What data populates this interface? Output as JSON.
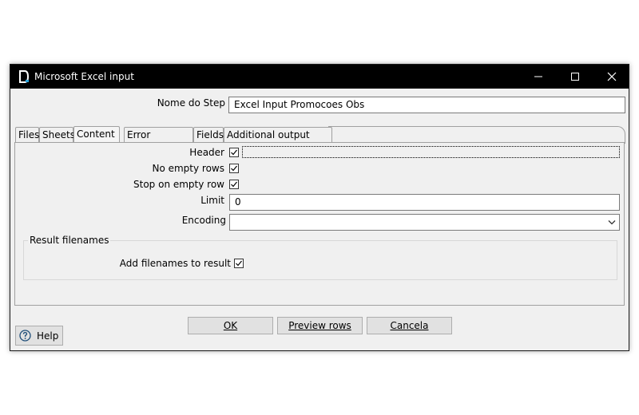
{
  "window": {
    "title": "Microsoft Excel input",
    "controls": {
      "minimize": "—",
      "maximize": "☐",
      "close": "✕"
    }
  },
  "step": {
    "label": "Nome do Step",
    "value": "Excel Input Promocoes Obs"
  },
  "tabs": [
    {
      "label": "Files"
    },
    {
      "label": "Sheets"
    },
    {
      "label": "Content",
      "active": true
    },
    {
      "label": "Error Handling"
    },
    {
      "label": "Fields"
    },
    {
      "label": "Additional output fields"
    }
  ],
  "content": {
    "header": {
      "label": "Header",
      "checked": true
    },
    "no_empty_rows": {
      "label": "No empty rows",
      "checked": true
    },
    "stop_on_empty_row": {
      "label": "Stop on empty row",
      "checked": true
    },
    "limit": {
      "label": "Limit",
      "value": "0"
    },
    "encoding": {
      "label": "Encoding",
      "value": ""
    }
  },
  "result_filenames": {
    "title": "Result filenames",
    "add_filenames": {
      "label": "Add filenames to result",
      "checked": true
    }
  },
  "buttons": {
    "ok": "OK",
    "preview": "Preview rows",
    "cancel": "Cancela",
    "help": "Help"
  },
  "icons": {
    "app": "spoon-icon",
    "help": "help-circle-icon",
    "dropdown": "chevron-down-icon"
  }
}
